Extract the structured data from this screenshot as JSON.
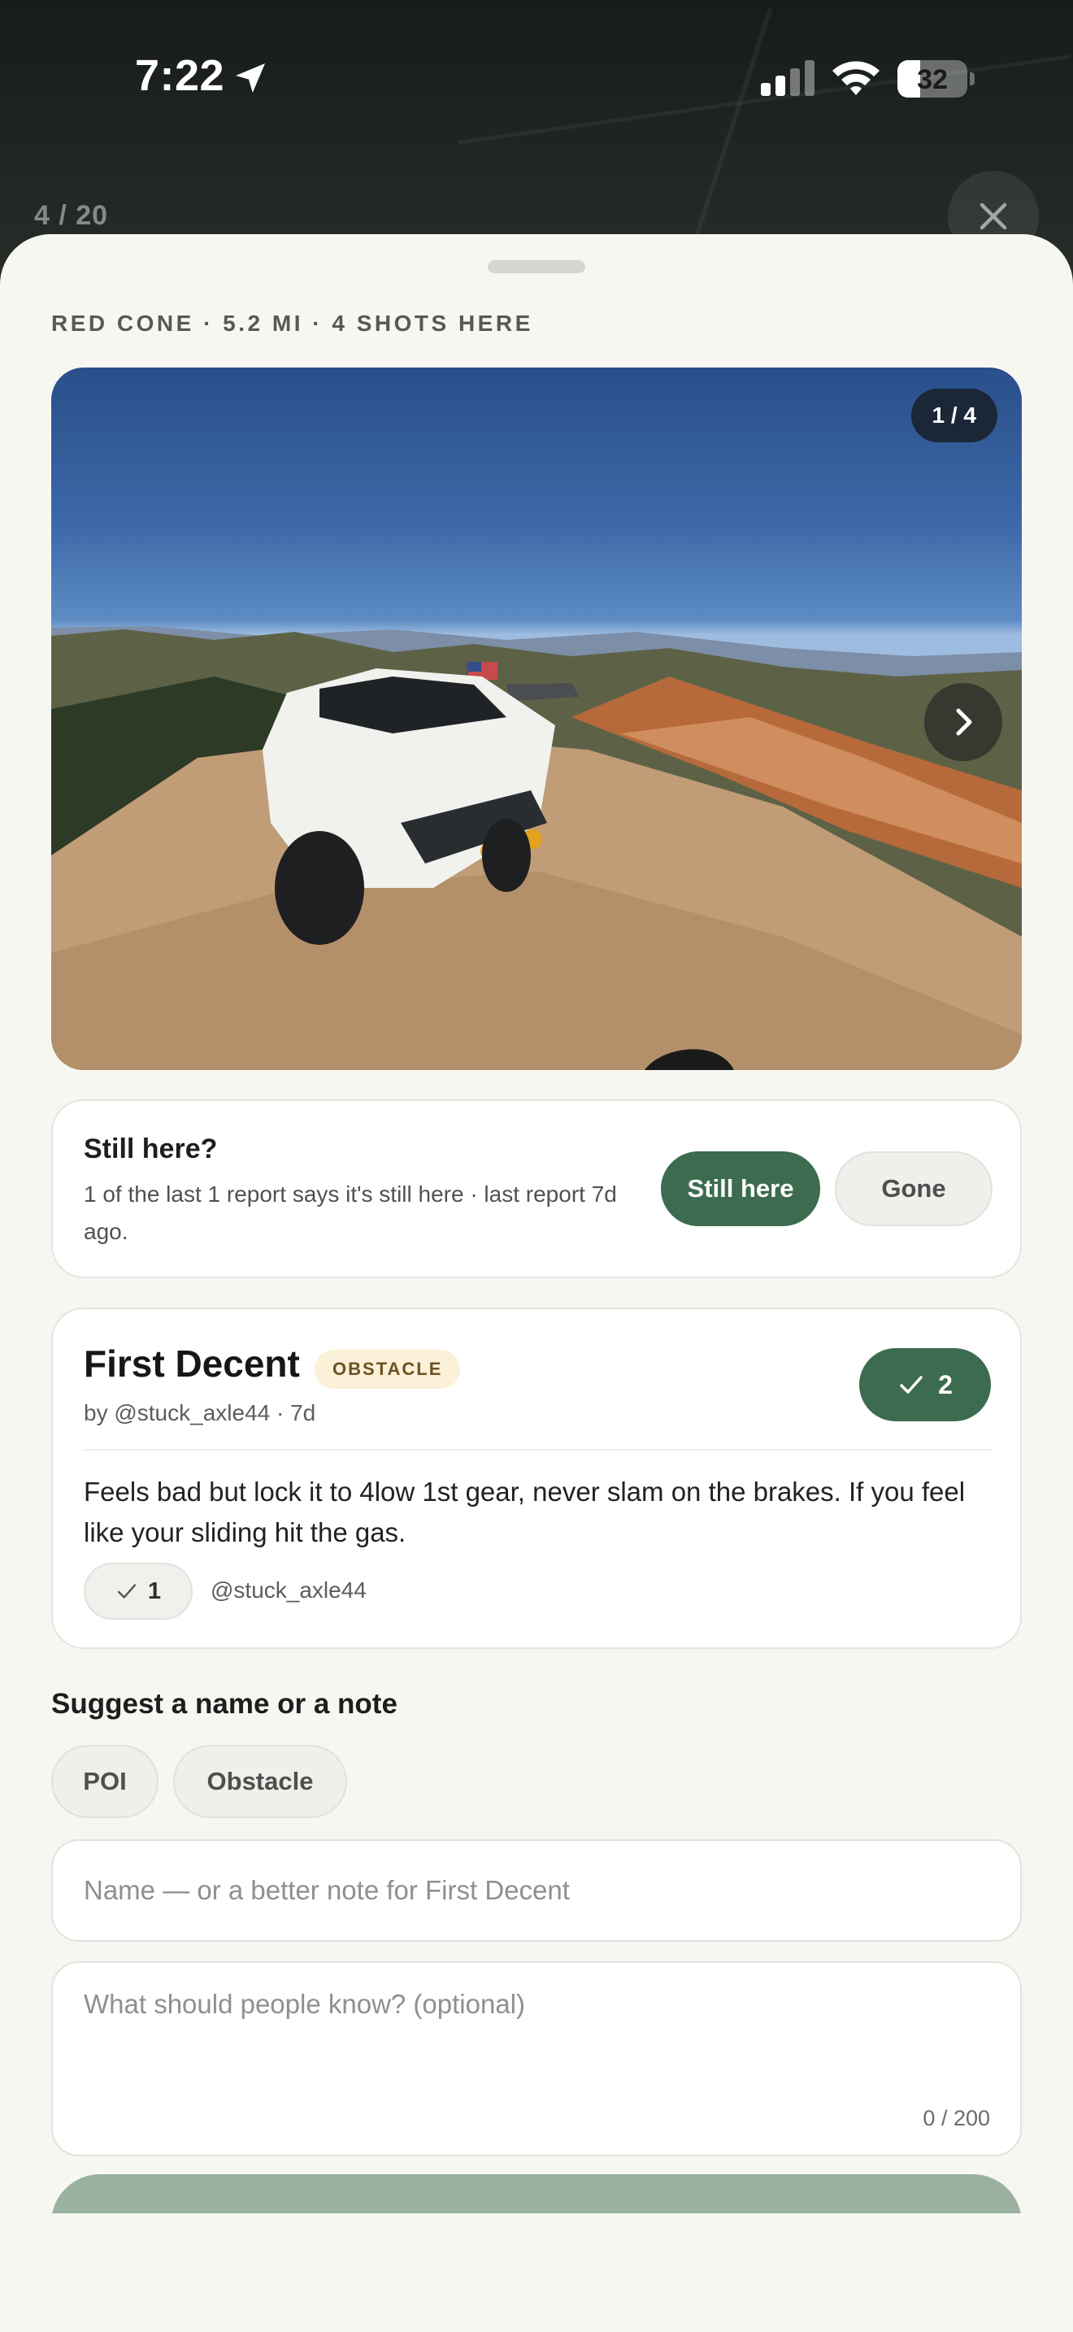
{
  "status_bar": {
    "time": "7:22",
    "battery": "32",
    "battery_level": 0.32
  },
  "viewer": {
    "counter": "4 / 20"
  },
  "sheet": {
    "eyebrow": "RED CONE · 5.2 MI · 4 SHOTS HERE",
    "photo": {
      "index_badge": "1 / 4"
    },
    "still_here": {
      "title": "Still here?",
      "text": "1 of the last 1 report says it's still here · last report 7d ago.",
      "still_label": "Still here",
      "gone_label": "Gone"
    },
    "note": {
      "title": "First Decent",
      "tag": "OBSTACLE",
      "byline": "by @stuck_axle44 · 7d",
      "vote_count": "2",
      "body": "Feels bad but lock it to 4low 1st gear, never slam on the brakes. If you feel like your sliding hit the gas.",
      "mini_vote_count": "1",
      "mini_author": "@stuck_axle44"
    },
    "suggest": {
      "title": "Suggest a name or a note",
      "chips": [
        "POI",
        "Obstacle"
      ],
      "name_placeholder": "Name — or a better note for First Decent",
      "note_placeholder": "What should people know? (optional)",
      "char_count": "0 / 200"
    }
  },
  "colors": {
    "accent_green": "#3d6b4f",
    "submit_disabled": "#9ab1a0",
    "tag_bg": "#fbf0d8",
    "sheet_bg": "#f7f7f2"
  },
  "icons": {
    "location": "location-arrow-icon",
    "close": "close-icon",
    "next": "chevron-right-icon",
    "check": "check-icon"
  }
}
